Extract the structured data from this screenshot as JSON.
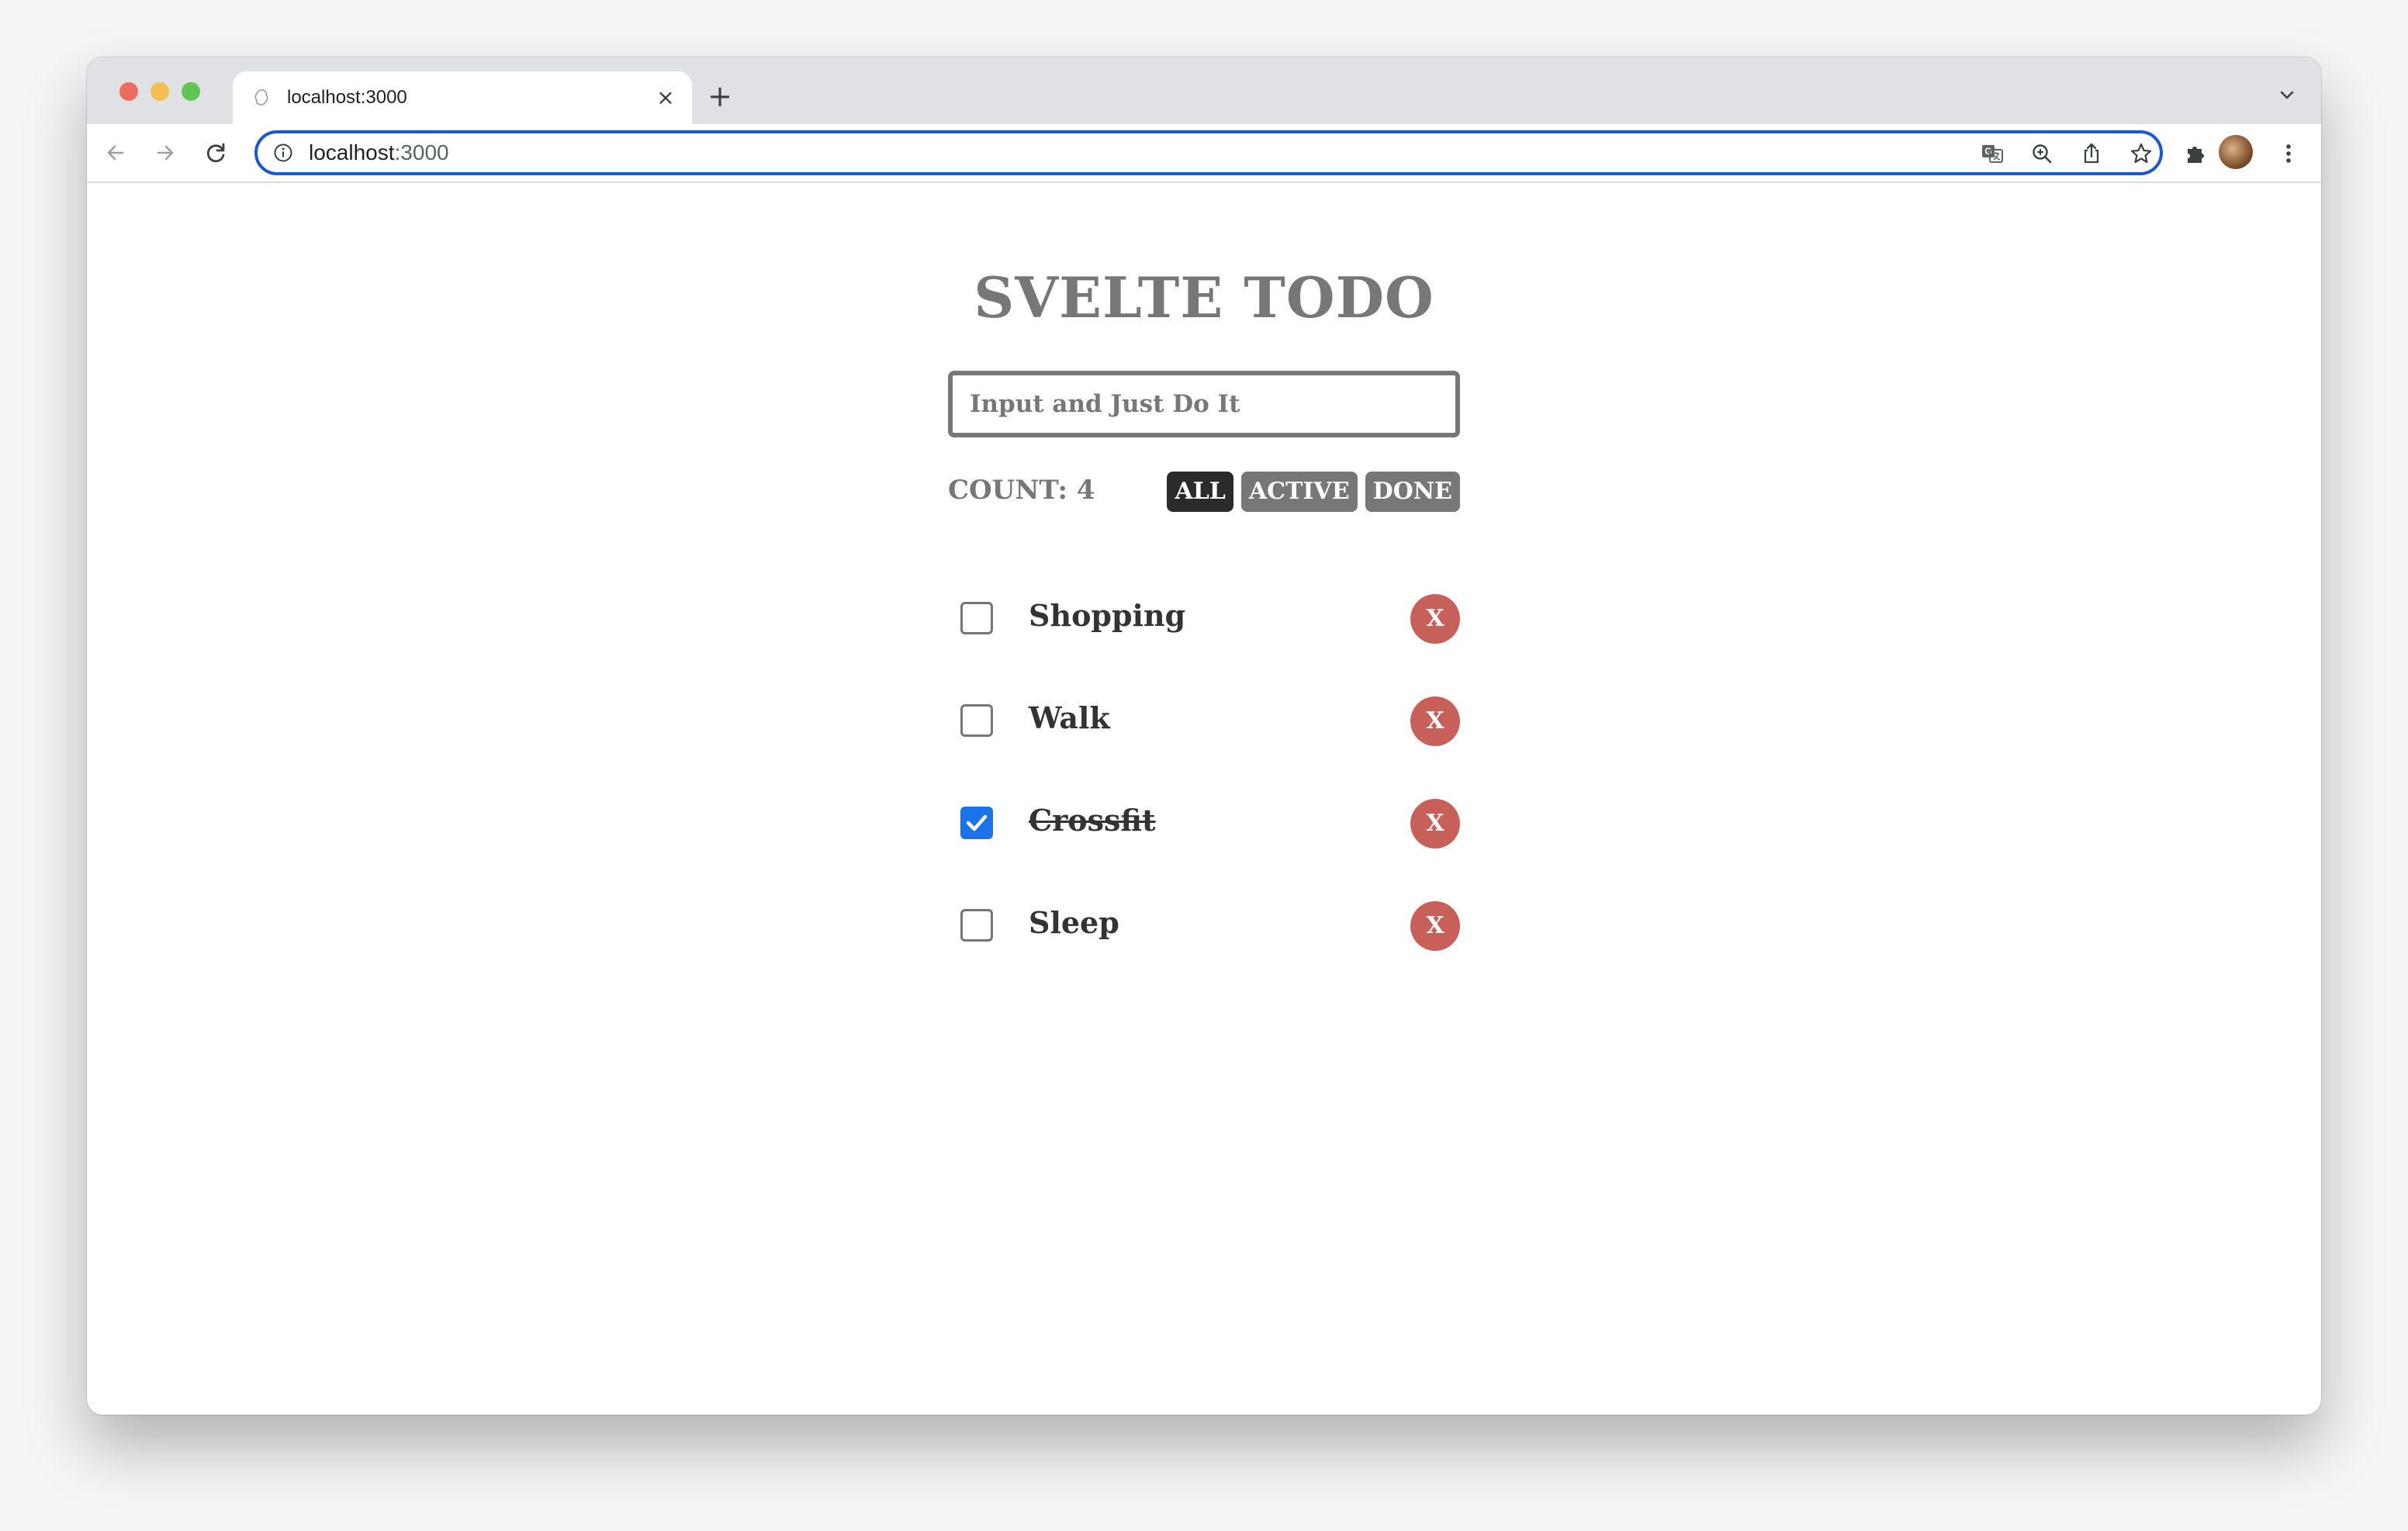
{
  "browser": {
    "tab_title": "localhost:3000",
    "tab_close": "×",
    "new_tab": "+",
    "url_host": "localhost",
    "url_port": ":3000"
  },
  "app": {
    "title": "SVELTE TODO",
    "input_placeholder": "Input and Just Do It",
    "input_value": "",
    "count_label": "COUNT: 4",
    "filters": [
      {
        "label": "ALL",
        "active": true
      },
      {
        "label": "ACTIVE",
        "active": false
      },
      {
        "label": "DONE",
        "active": false
      }
    ],
    "todos": [
      {
        "text": "Shopping",
        "done": false,
        "remove_label": "X"
      },
      {
        "text": "Walk",
        "done": false,
        "remove_label": "X"
      },
      {
        "text": "Crossfit",
        "done": true,
        "remove_label": "X"
      },
      {
        "text": "Sleep",
        "done": false,
        "remove_label": "X"
      }
    ]
  },
  "colors": {
    "title": "#777777",
    "filter_active": "#2b2b2b",
    "filter_inactive": "#777777",
    "remove_button": "#c8605a",
    "checkbox_checked": "#1a73e8",
    "omnibox_focus": "#1a57d6"
  },
  "icons": {
    "back": "arrow-left-icon",
    "forward": "arrow-right-icon",
    "reload": "reload-icon",
    "info": "info-icon",
    "translate": "translate-icon",
    "zoom": "zoom-icon",
    "share": "share-icon",
    "bookmark": "star-icon",
    "extensions": "puzzle-icon",
    "menu": "kebab-menu-icon"
  }
}
